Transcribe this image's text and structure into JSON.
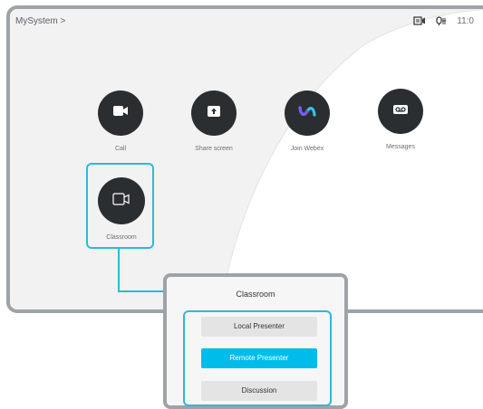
{
  "header": {
    "breadcrumb": "MySystem >",
    "time": "11:0",
    "icons": [
      "screen-share-status-icon",
      "microphone-status-icon"
    ]
  },
  "apps": [
    {
      "label": "Call",
      "icon": "video-camera-icon"
    },
    {
      "label": "Share screen",
      "icon": "upload-arrow-icon"
    },
    {
      "label": "Join Webex",
      "icon": "webex-logo-icon"
    },
    {
      "label": "Messages",
      "icon": "voicemail-icon"
    },
    {
      "label": "Classroom",
      "icon": "camera-outline-icon"
    }
  ],
  "panel": {
    "title": "Classroom",
    "options": [
      {
        "label": "Local Presenter",
        "active": false
      },
      {
        "label": "Remote Presenter",
        "active": true
      },
      {
        "label": "Discussion",
        "active": false
      }
    ]
  },
  "colors": {
    "highlight": "#2bbbd6",
    "accent": "#00bceb",
    "icon_bg": "#2b2e31",
    "frame": "#9ea3a8"
  }
}
